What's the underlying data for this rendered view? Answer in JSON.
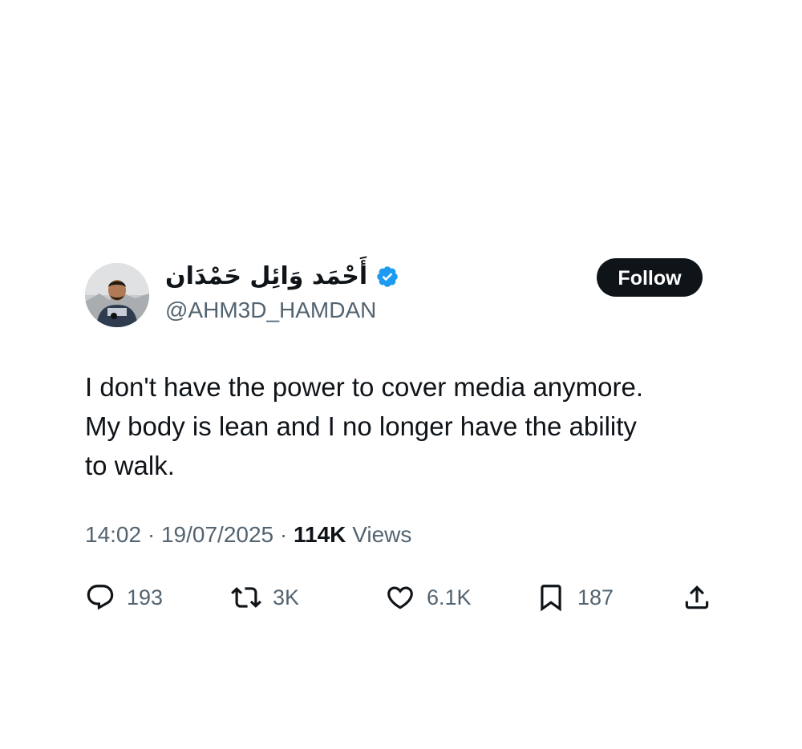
{
  "author": {
    "display_name": "أَحْمَد وَائِل حَمْدَان",
    "handle": "@AHM3D_HAMDAN",
    "verified": true
  },
  "follow_button": {
    "label": "Follow"
  },
  "tweet": {
    "lines": [
      "I don't have the power to cover media anymore.",
      "My body is lean and I no longer have the ability",
      "to walk."
    ]
  },
  "meta": {
    "time": "14:02",
    "date": "19/07/2025",
    "separator": "·",
    "views_count": "114K",
    "views_label": "Views"
  },
  "actions": {
    "replies": "193",
    "reposts": "3K",
    "likes": "6.1K",
    "bookmarks": "187"
  },
  "colors": {
    "text": "#0f1419",
    "secondary": "#536471",
    "verified": "#1d9bf0",
    "button_bg": "#0f1419"
  }
}
